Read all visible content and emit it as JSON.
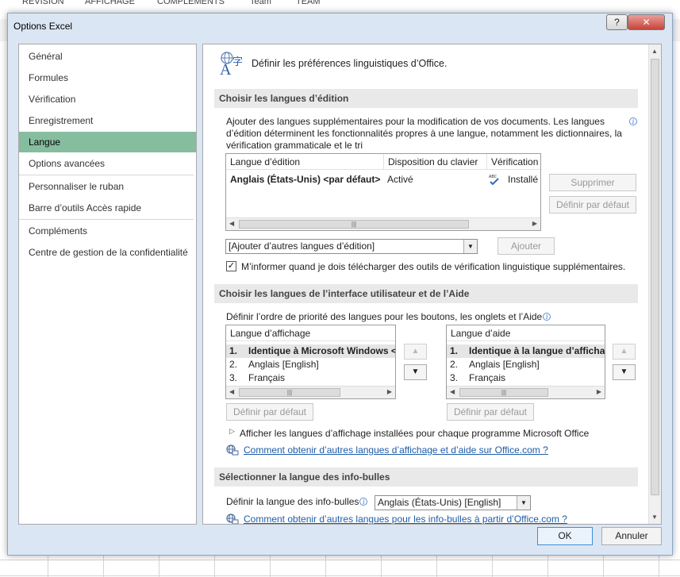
{
  "background": {
    "tabs": [
      "RÉVISION",
      "AFFICHAGE",
      "COMPLÉMENTS",
      "Team",
      "TEAM"
    ]
  },
  "dialog": {
    "title": "Options Excel",
    "help_label": "?",
    "close_label": "✕",
    "ok_label": "OK",
    "cancel_label": "Annuler"
  },
  "nav": {
    "items": [
      {
        "label": "Général"
      },
      {
        "label": "Formules"
      },
      {
        "label": "Vérification"
      },
      {
        "label": "Enregistrement"
      },
      {
        "label": "Langue"
      },
      {
        "label": "Options avancées"
      },
      {
        "label": "Personnaliser le ruban"
      },
      {
        "label": "Barre d’outils Accès rapide"
      },
      {
        "label": "Compléments"
      },
      {
        "label": "Centre de gestion de la confidentialité"
      }
    ],
    "active": "Langue"
  },
  "content": {
    "header": "Définir les préférences linguistiques d’Office.",
    "editing": {
      "section_title": "Choisir les langues d’édition",
      "description_lines": [
        "Ajouter des langues supplémentaires pour la modification de vos documents. Les langues",
        "d’édition déterminent les fonctionnalités propres à une langue, notamment les dictionnaires, la",
        "vérification grammaticale et le tri"
      ],
      "columns": [
        "Langue d’édition",
        "Disposition du clavier",
        "Vérification"
      ],
      "rows": [
        {
          "language": "Anglais (États-Unis) <par défaut>",
          "keyboard": "Activé",
          "proofing": "Installé"
        }
      ],
      "remove_button": "Supprimer",
      "default_button": "Définir par défaut",
      "add_combo_value": "[Ajouter d’autres langues d’édition]",
      "add_button": "Ajouter",
      "notify_checkbox_label": "M’informer quand je dois télécharger des outils de vérification linguistique supplémentaires.",
      "notify_checked": true
    },
    "ui": {
      "section_title": "Choisir les langues de l’interface utilisateur et de l’Aide",
      "description": "Définir l’ordre de priorité des langues pour les boutons, les onglets et l’Aide",
      "display": {
        "header": "Langue d’affichage",
        "rows": [
          {
            "num": "1.",
            "label": "Identique à Microsoft Windows <"
          },
          {
            "num": "2.",
            "label": "Anglais [English]"
          },
          {
            "num": "3.",
            "label": "Français"
          }
        ],
        "default_button": "Définir par défaut"
      },
      "help": {
        "header": "Langue d’aide",
        "rows": [
          {
            "num": "1.",
            "label": "Identique à la langue d’affichag"
          },
          {
            "num": "2.",
            "label": "Anglais [English]"
          },
          {
            "num": "3.",
            "label": "Français"
          }
        ],
        "default_button": "Définir par défaut"
      },
      "expander_label": "Afficher les langues d’affichage installées pour chaque programme Microsoft Office",
      "link": "Comment obtenir d’autres langues d’affichage et d’aide sur Office.com ?"
    },
    "tooltips": {
      "section_title": "Sélectionner la langue des info-bulles",
      "label": "Définir la langue des info-bulles",
      "combo_value": "Anglais (États-Unis) [English]",
      "link": "Comment obtenir d’autres langues pour les info-bulles à partir d’Office.com ?"
    }
  }
}
